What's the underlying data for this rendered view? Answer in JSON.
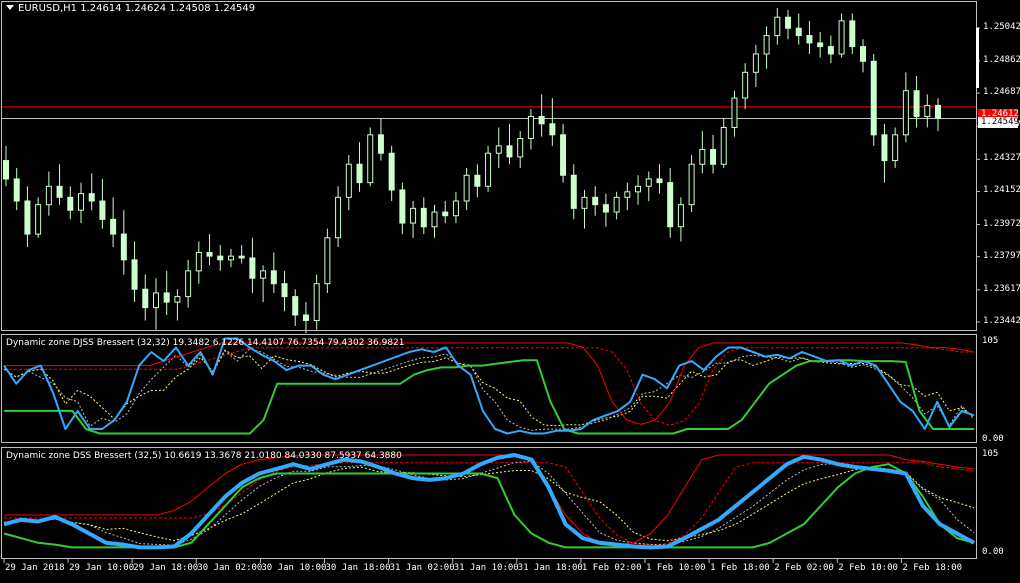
{
  "main_chart": {
    "symbol_header": "EURUSD,H1  1.24614 1.24624 1.24508 1.24549",
    "price_ticks": [
      "1.25042",
      "1.24862",
      "1.24687",
      "1.24507",
      "1.24327",
      "1.24152",
      "1.23972",
      "1.23797",
      "1.23617",
      "1.23442"
    ],
    "red_line_price": "1.24612",
    "current_price": "1.24549",
    "colors": {
      "bull": "#ccffcc",
      "bear": "#ccffcc",
      "red_line": "#ff0000",
      "cur_line": "#ffffff"
    }
  },
  "indicator1": {
    "title": "Dynamic zone DJSS Bressert (32,32) 19.3482 6.1226 14.4107 76.7354 79.4302 36.9821",
    "top_label": "105",
    "bottom_label": "0.00"
  },
  "indicator2": {
    "title": "Dynamic zone DSS Bressert (32,5) 10.6619 13.3678 21.0180 84.0330 87.5937 64.3880",
    "top_label": "105",
    "bottom_label": "0.00"
  },
  "time_axis": [
    "29 Jan 2018",
    "29 Jan 10:00",
    "29 Jan 18:00",
    "30 Jan 02:00",
    "30 Jan 10:00",
    "30 Jan 18:00",
    "31 Jan 02:00",
    "31 Jan 10:00",
    "31 Jan 18:00",
    "1 Feb 02:00",
    "1 Feb 10:00",
    "1 Feb 18:00",
    "2 Feb 02:00",
    "2 Feb 10:00",
    "2 Feb 18:00"
  ],
  "series_colors": {
    "blue": "#33aaff",
    "green": "#33cc33",
    "red": "#ff0000",
    "yellow": "#ffff66",
    "white": "#c0c0c0"
  },
  "candles": [
    [
      1.2432,
      1.244,
      1.2418,
      1.2422
    ],
    [
      1.2422,
      1.2428,
      1.2405,
      1.241
    ],
    [
      1.241,
      1.2418,
      1.2385,
      1.2392
    ],
    [
      1.2392,
      1.2412,
      1.239,
      1.2408
    ],
    [
      1.2408,
      1.2426,
      1.2402,
      1.2418
    ],
    [
      1.2418,
      1.243,
      1.2408,
      1.2412
    ],
    [
      1.2412,
      1.2418,
      1.24,
      1.2405
    ],
    [
      1.2405,
      1.242,
      1.2398,
      1.2414
    ],
    [
      1.2414,
      1.2425,
      1.2405,
      1.241
    ],
    [
      1.241,
      1.2422,
      1.2395,
      1.24
    ],
    [
      1.24,
      1.2412,
      1.2385,
      1.2392
    ],
    [
      1.2392,
      1.2405,
      1.237,
      1.2378
    ],
    [
      1.2378,
      1.2388,
      1.2355,
      1.2362
    ],
    [
      1.2362,
      1.237,
      1.2345,
      1.2352
    ],
    [
      1.2352,
      1.2368,
      1.234,
      1.236
    ],
    [
      1.236,
      1.2372,
      1.2348,
      1.2355
    ],
    [
      1.2355,
      1.2362,
      1.2345,
      1.2358
    ],
    [
      1.2358,
      1.2378,
      1.2352,
      1.2372
    ],
    [
      1.2372,
      1.2388,
      1.2365,
      1.2382
    ],
    [
      1.2382,
      1.2392,
      1.2375,
      1.238
    ],
    [
      1.238,
      1.2386,
      1.2372,
      1.2378
    ],
    [
      1.2378,
      1.2384,
      1.2374,
      1.238
    ],
    [
      1.238,
      1.2386,
      1.2376,
      1.2379
    ],
    [
      1.2379,
      1.239,
      1.236,
      1.2368
    ],
    [
      1.2368,
      1.2375,
      1.2355,
      1.2372
    ],
    [
      1.2372,
      1.2382,
      1.236,
      1.2365
    ],
    [
      1.2365,
      1.2372,
      1.235,
      1.2358
    ],
    [
      1.2358,
      1.2362,
      1.2342,
      1.2348
    ],
    [
      1.2348,
      1.2355,
      1.2338,
      1.2345
    ],
    [
      1.2345,
      1.237,
      1.234,
      1.2365
    ],
    [
      1.2365,
      1.2395,
      1.236,
      1.239
    ],
    [
      1.239,
      1.2418,
      1.2385,
      1.2412
    ],
    [
      1.2412,
      1.2435,
      1.2405,
      1.243
    ],
    [
      1.243,
      1.2442,
      1.2415,
      1.242
    ],
    [
      1.242,
      1.245,
      1.2418,
      1.2446
    ],
    [
      1.2446,
      1.2455,
      1.2432,
      1.2436
    ],
    [
      1.2436,
      1.244,
      1.241,
      1.2416
    ],
    [
      1.2416,
      1.242,
      1.2392,
      1.2398
    ],
    [
      1.2398,
      1.241,
      1.239,
      1.2406
    ],
    [
      1.2406,
      1.2412,
      1.2392,
      1.2396
    ],
    [
      1.2396,
      1.2408,
      1.239,
      1.2404
    ],
    [
      1.2404,
      1.241,
      1.2398,
      1.2402
    ],
    [
      1.2402,
      1.2415,
      1.2398,
      1.241
    ],
    [
      1.241,
      1.2428,
      1.2405,
      1.2424
    ],
    [
      1.2424,
      1.243,
      1.2412,
      1.2418
    ],
    [
      1.2418,
      1.244,
      1.2415,
      1.2436
    ],
    [
      1.2436,
      1.245,
      1.2428,
      1.244
    ],
    [
      1.244,
      1.2452,
      1.243,
      1.2434
    ],
    [
      1.2434,
      1.2448,
      1.2428,
      1.2444
    ],
    [
      1.2444,
      1.246,
      1.2438,
      1.2456
    ],
    [
      1.2456,
      1.2468,
      1.2445,
      1.2452
    ],
    [
      1.2452,
      1.2466,
      1.244,
      1.2446
    ],
    [
      1.2446,
      1.2452,
      1.242,
      1.2424
    ],
    [
      1.2424,
      1.243,
      1.24,
      1.2406
    ],
    [
      1.2406,
      1.2416,
      1.2395,
      1.2412
    ],
    [
      1.2412,
      1.2418,
      1.2402,
      1.2408
    ],
    [
      1.2408,
      1.2414,
      1.2396,
      1.2404
    ],
    [
      1.2404,
      1.2415,
      1.24,
      1.2412
    ],
    [
      1.2412,
      1.242,
      1.2405,
      1.2415
    ],
    [
      1.2415,
      1.2424,
      1.2408,
      1.2418
    ],
    [
      1.2418,
      1.2426,
      1.241,
      1.2422
    ],
    [
      1.2422,
      1.243,
      1.2414,
      1.242
    ],
    [
      1.242,
      1.2428,
      1.239,
      1.2396
    ],
    [
      1.2396,
      1.2412,
      1.2388,
      1.2408
    ],
    [
      1.2408,
      1.2435,
      1.2404,
      1.243
    ],
    [
      1.243,
      1.2448,
      1.2425,
      1.2438
    ],
    [
      1.2438,
      1.2446,
      1.2425,
      1.243
    ],
    [
      1.243,
      1.2455,
      1.2428,
      1.245
    ],
    [
      1.245,
      1.247,
      1.2445,
      1.2466
    ],
    [
      1.2466,
      1.2485,
      1.246,
      1.248
    ],
    [
      1.248,
      1.2495,
      1.2472,
      1.249
    ],
    [
      1.249,
      1.2505,
      1.2482,
      1.25
    ],
    [
      1.25,
      1.2515,
      1.2495,
      1.251
    ],
    [
      1.251,
      1.2514,
      1.2498,
      1.2504
    ],
    [
      1.2504,
      1.2512,
      1.2495,
      1.25
    ],
    [
      1.25,
      1.2508,
      1.249,
      1.2496
    ],
    [
      1.2496,
      1.2502,
      1.2488,
      1.2494
    ],
    [
      1.2494,
      1.25,
      1.2485,
      1.249
    ],
    [
      1.249,
      1.2512,
      1.2488,
      1.2508
    ],
    [
      1.2508,
      1.2512,
      1.249,
      1.2494
    ],
    [
      1.2494,
      1.2498,
      1.248,
      1.2486
    ],
    [
      1.2486,
      1.249,
      1.244,
      1.2446
    ],
    [
      1.2446,
      1.2452,
      1.242,
      1.2432
    ],
    [
      1.2432,
      1.245,
      1.2428,
      1.2446
    ],
    [
      1.2446,
      1.248,
      1.2442,
      1.247
    ],
    [
      1.247,
      1.2478,
      1.245,
      1.2456
    ],
    [
      1.2456,
      1.2468,
      1.245,
      1.2462
    ],
    [
      1.2462,
      1.2466,
      1.2448,
      1.2455
    ]
  ],
  "ind1_blue": [
    80,
    60,
    75,
    80,
    50,
    10,
    30,
    10,
    10,
    20,
    40,
    80,
    95,
    85,
    100,
    80,
    95,
    70,
    110,
    110,
    100,
    92,
    85,
    75,
    80,
    80,
    70,
    65,
    70,
    75,
    80,
    85,
    90,
    95,
    98,
    95,
    100,
    80,
    70,
    30,
    10,
    5,
    8,
    5,
    5,
    8,
    8,
    10,
    20,
    25,
    30,
    40,
    70,
    65,
    55,
    80,
    85,
    75,
    90,
    100,
    100,
    95,
    90,
    92,
    88,
    95,
    90,
    85,
    86,
    80,
    85,
    80,
    60,
    40,
    30,
    10,
    40,
    12,
    30,
    25
  ],
  "ind1_green": [
    30,
    30,
    30,
    30,
    30,
    30,
    10,
    5,
    5,
    5,
    5,
    5,
    5,
    5,
    5,
    5,
    5,
    5,
    5,
    20,
    60,
    60,
    60,
    60,
    60,
    60,
    60,
    60,
    60,
    60,
    70,
    75,
    78,
    78,
    80,
    80,
    82,
    84,
    86,
    86,
    40,
    10,
    5,
    5,
    5,
    5,
    5,
    5,
    5,
    5,
    10,
    10,
    10,
    10,
    20,
    40,
    60,
    70,
    80,
    85,
    85,
    86,
    86,
    85,
    85,
    85,
    84,
    30,
    10,
    10,
    10,
    10
  ],
  "ind1_red": [
    80,
    80,
    80,
    80,
    80,
    80,
    80,
    80,
    80,
    80,
    80,
    85,
    90,
    95,
    100,
    105,
    105,
    105,
    105,
    105,
    105,
    105,
    105,
    105,
    105,
    105,
    105,
    105,
    105,
    105,
    105,
    105,
    105,
    105,
    105,
    105,
    105,
    105,
    105,
    105,
    100,
    80,
    40,
    20,
    15,
    20,
    40,
    80,
    100,
    105,
    105,
    105,
    105,
    105,
    105,
    105,
    105,
    105,
    105,
    105,
    105,
    105,
    105,
    103,
    100,
    100,
    98,
    95
  ],
  "ind2_blue": [
    30,
    35,
    33,
    38,
    30,
    20,
    10,
    8,
    5,
    5,
    6,
    20,
    40,
    60,
    75,
    85,
    90,
    95,
    90,
    95,
    100,
    98,
    92,
    85,
    80,
    78,
    80,
    85,
    95,
    102,
    105,
    100,
    70,
    30,
    15,
    10,
    8,
    6,
    5,
    6,
    15,
    25,
    35,
    50,
    65,
    80,
    95,
    103,
    100,
    95,
    92,
    90,
    88,
    85,
    50,
    30,
    20,
    10
  ],
  "ind2_green": [
    20,
    15,
    10,
    8,
    5,
    5,
    5,
    5,
    5,
    5,
    5,
    10,
    30,
    50,
    70,
    80,
    85,
    85,
    85,
    85,
    85,
    85,
    85,
    85,
    85,
    85,
    85,
    85,
    85,
    80,
    40,
    20,
    10,
    5,
    5,
    5,
    5,
    5,
    5,
    5,
    5,
    5,
    5,
    5,
    5,
    10,
    20,
    30,
    50,
    70,
    85,
    92,
    95,
    85,
    60,
    30,
    15,
    10
  ],
  "ind2_red": [
    40,
    40,
    40,
    40,
    40,
    40,
    40,
    40,
    40,
    40,
    45,
    55,
    70,
    85,
    95,
    100,
    102,
    104,
    105,
    105,
    105,
    105,
    105,
    105,
    105,
    105,
    105,
    105,
    105,
    105,
    105,
    100,
    70,
    40,
    20,
    10,
    8,
    10,
    20,
    40,
    70,
    100,
    105,
    105,
    105,
    105,
    105,
    105,
    105,
    105,
    105,
    105,
    105,
    100,
    98,
    95,
    92,
    90
  ]
}
